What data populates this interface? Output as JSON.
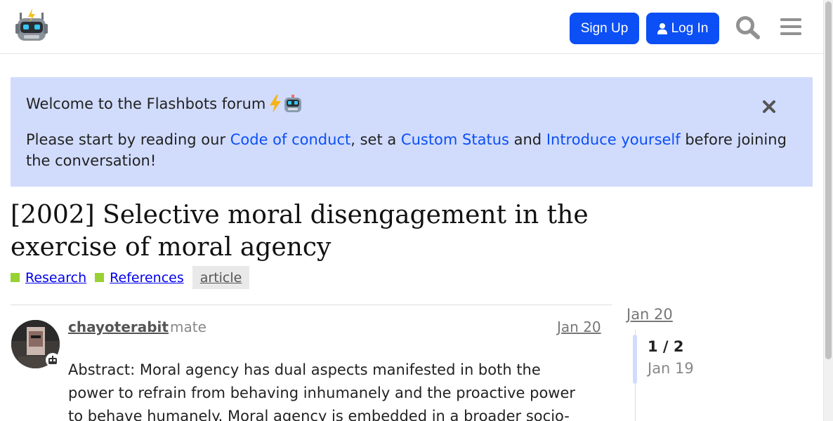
{
  "header": {
    "logo_name": "flashbots-robot-logo",
    "signup_label": "Sign Up",
    "login_label": "Log In"
  },
  "banner": {
    "title": "Welcome to the Flashbots forum",
    "text_1": "Please start by reading our ",
    "link_code_of_conduct": "Code of conduct",
    "text_2": ", set a ",
    "link_custom_status": "Custom Status",
    "text_3": " and ",
    "link_introduce_yourself": "Introduce yourself",
    "text_4": " before joining the conversation!"
  },
  "topic": {
    "title": "[2002] Selective moral disengagement in the exercise of moral agency",
    "categories": [
      "Research",
      "References"
    ],
    "tag": "article",
    "category_color": "#99d033"
  },
  "post": {
    "username": "chayoterabit",
    "user_title": "mate",
    "date": "Jan 20",
    "body": "Abstract: Moral agency has dual aspects manifested in both the power to refrain from behaving inhumanely and the proactive power to behave humanely. Moral agency is embedded in a broader socio-"
  },
  "timeline": {
    "top_date": "Jan 20",
    "position": "1 / 2",
    "bottom_date": "Jan 19"
  },
  "colors": {
    "accent": "#0b4ff5",
    "banner_bg": "#d1dcfd"
  }
}
